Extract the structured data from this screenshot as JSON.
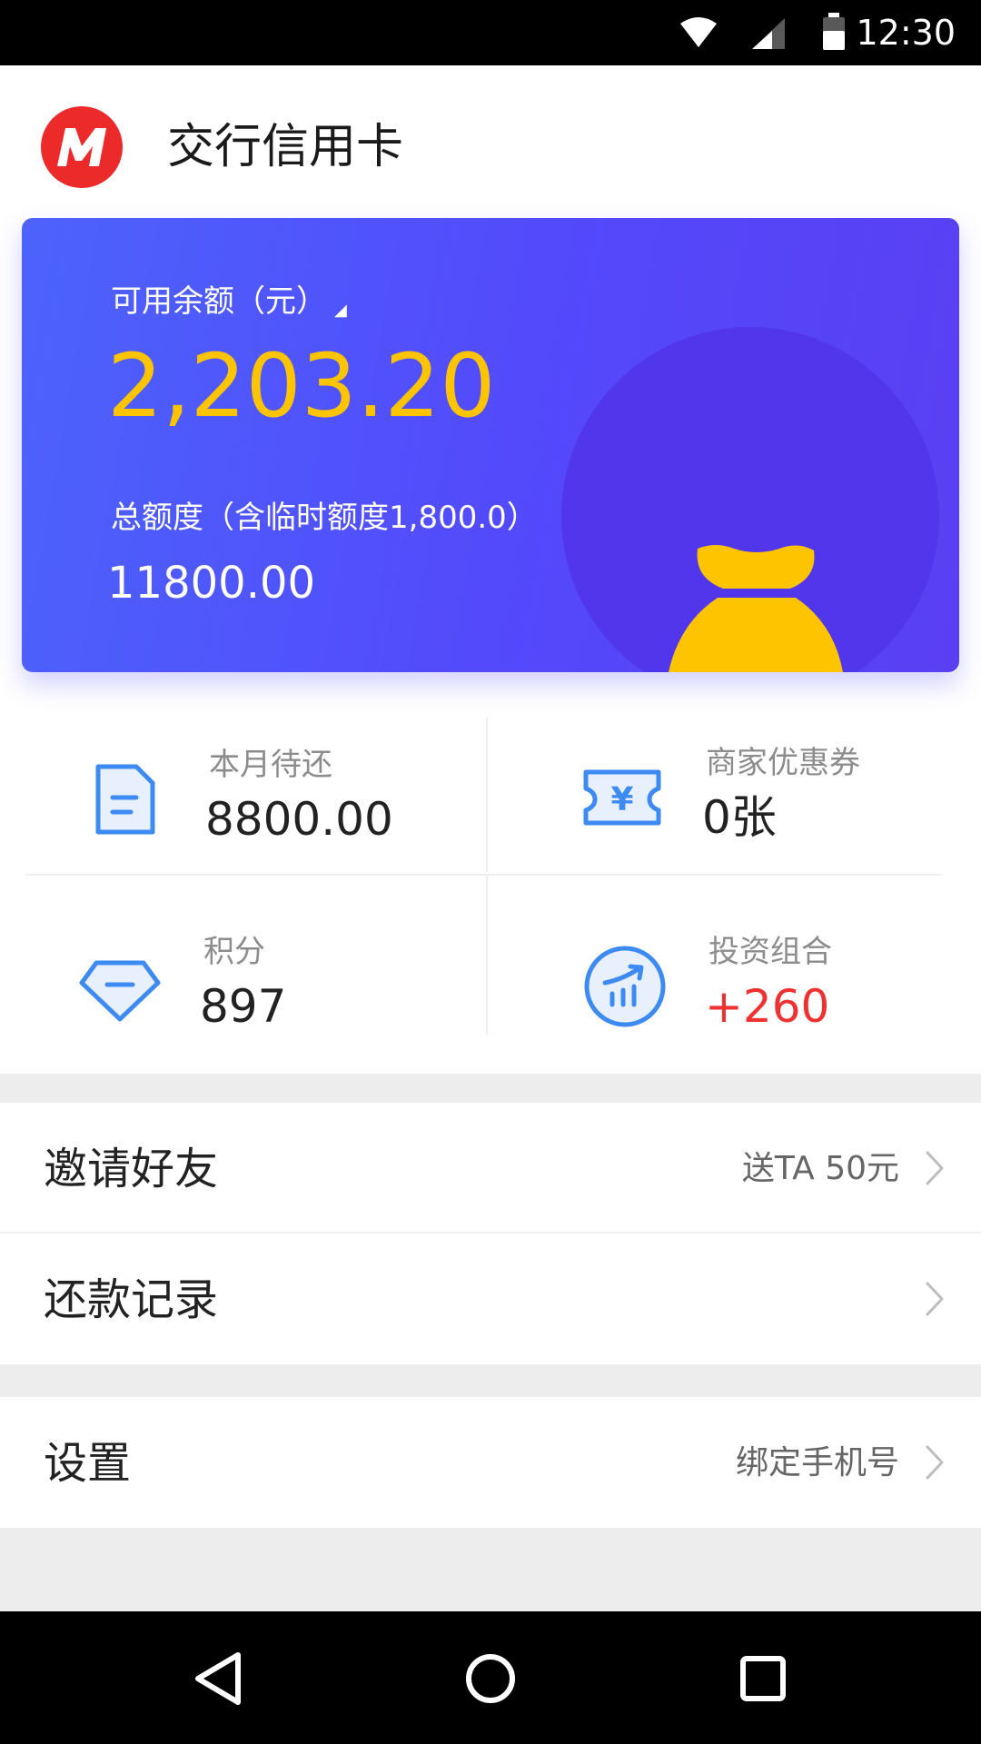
{
  "status_bar": {
    "time": "12:30",
    "icons": [
      "wifi-icon",
      "signal-icon",
      "battery-icon"
    ]
  },
  "header": {
    "logo_icon": "bank-logo-icon",
    "title": "交行信用卡"
  },
  "balance_card": {
    "available_label": "可用余额（元）",
    "available_amount": "2,203.20",
    "total_label": "总额度（含临时额度1,800.0）",
    "total_amount": "11800.00",
    "colors": {
      "gradient_start": "#4c63fb",
      "gradient_end": "#5a3ff2",
      "amount": "#ffc400"
    }
  },
  "stats": [
    {
      "icon": "bill-icon",
      "label": "本月待还",
      "value": "8800.00"
    },
    {
      "icon": "coupon-icon",
      "label": "商家优惠券",
      "value": "0张"
    },
    {
      "icon": "diamond-icon",
      "label": "积分",
      "value": "897"
    },
    {
      "icon": "investment-chart-icon",
      "label": "投资组合",
      "value": "+260"
    }
  ],
  "menu": {
    "invite": {
      "label": "邀请好友",
      "hint": "送TA 50元"
    },
    "repayment_history": {
      "label": "还款记录",
      "hint": ""
    },
    "settings": {
      "label": "设置",
      "hint": "绑定手机号"
    }
  },
  "nav_bar": {
    "buttons": [
      "back-icon",
      "home-icon",
      "recents-icon"
    ]
  },
  "theme": {
    "accent_blue": "#3d8bf2",
    "positive_red": "#ef3131"
  }
}
